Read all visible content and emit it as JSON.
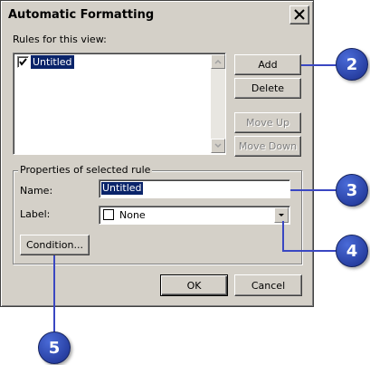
{
  "dialog": {
    "title": "Automatic Formatting",
    "rules_label": "Rules for this view:",
    "rules": [
      {
        "label": "Untitled",
        "checked": true,
        "selected": true
      }
    ],
    "buttons": {
      "add": "Add",
      "delete": "Delete",
      "move_up": "Move Up",
      "move_down": "Move Down",
      "condition": "Condition...",
      "ok": "OK",
      "cancel": "Cancel"
    },
    "properties_group": "Properties of selected rule",
    "name_label": "Name:",
    "name_value": "Untitled",
    "label_label": "Label:",
    "label_value": "None"
  },
  "callouts": {
    "c2": "2",
    "c3": "3",
    "c4": "4",
    "c5": "5"
  },
  "colors": {
    "dialog_face": "#d4d0c8",
    "callout_blue": "#2a44b8",
    "selection": "#0a246a"
  }
}
